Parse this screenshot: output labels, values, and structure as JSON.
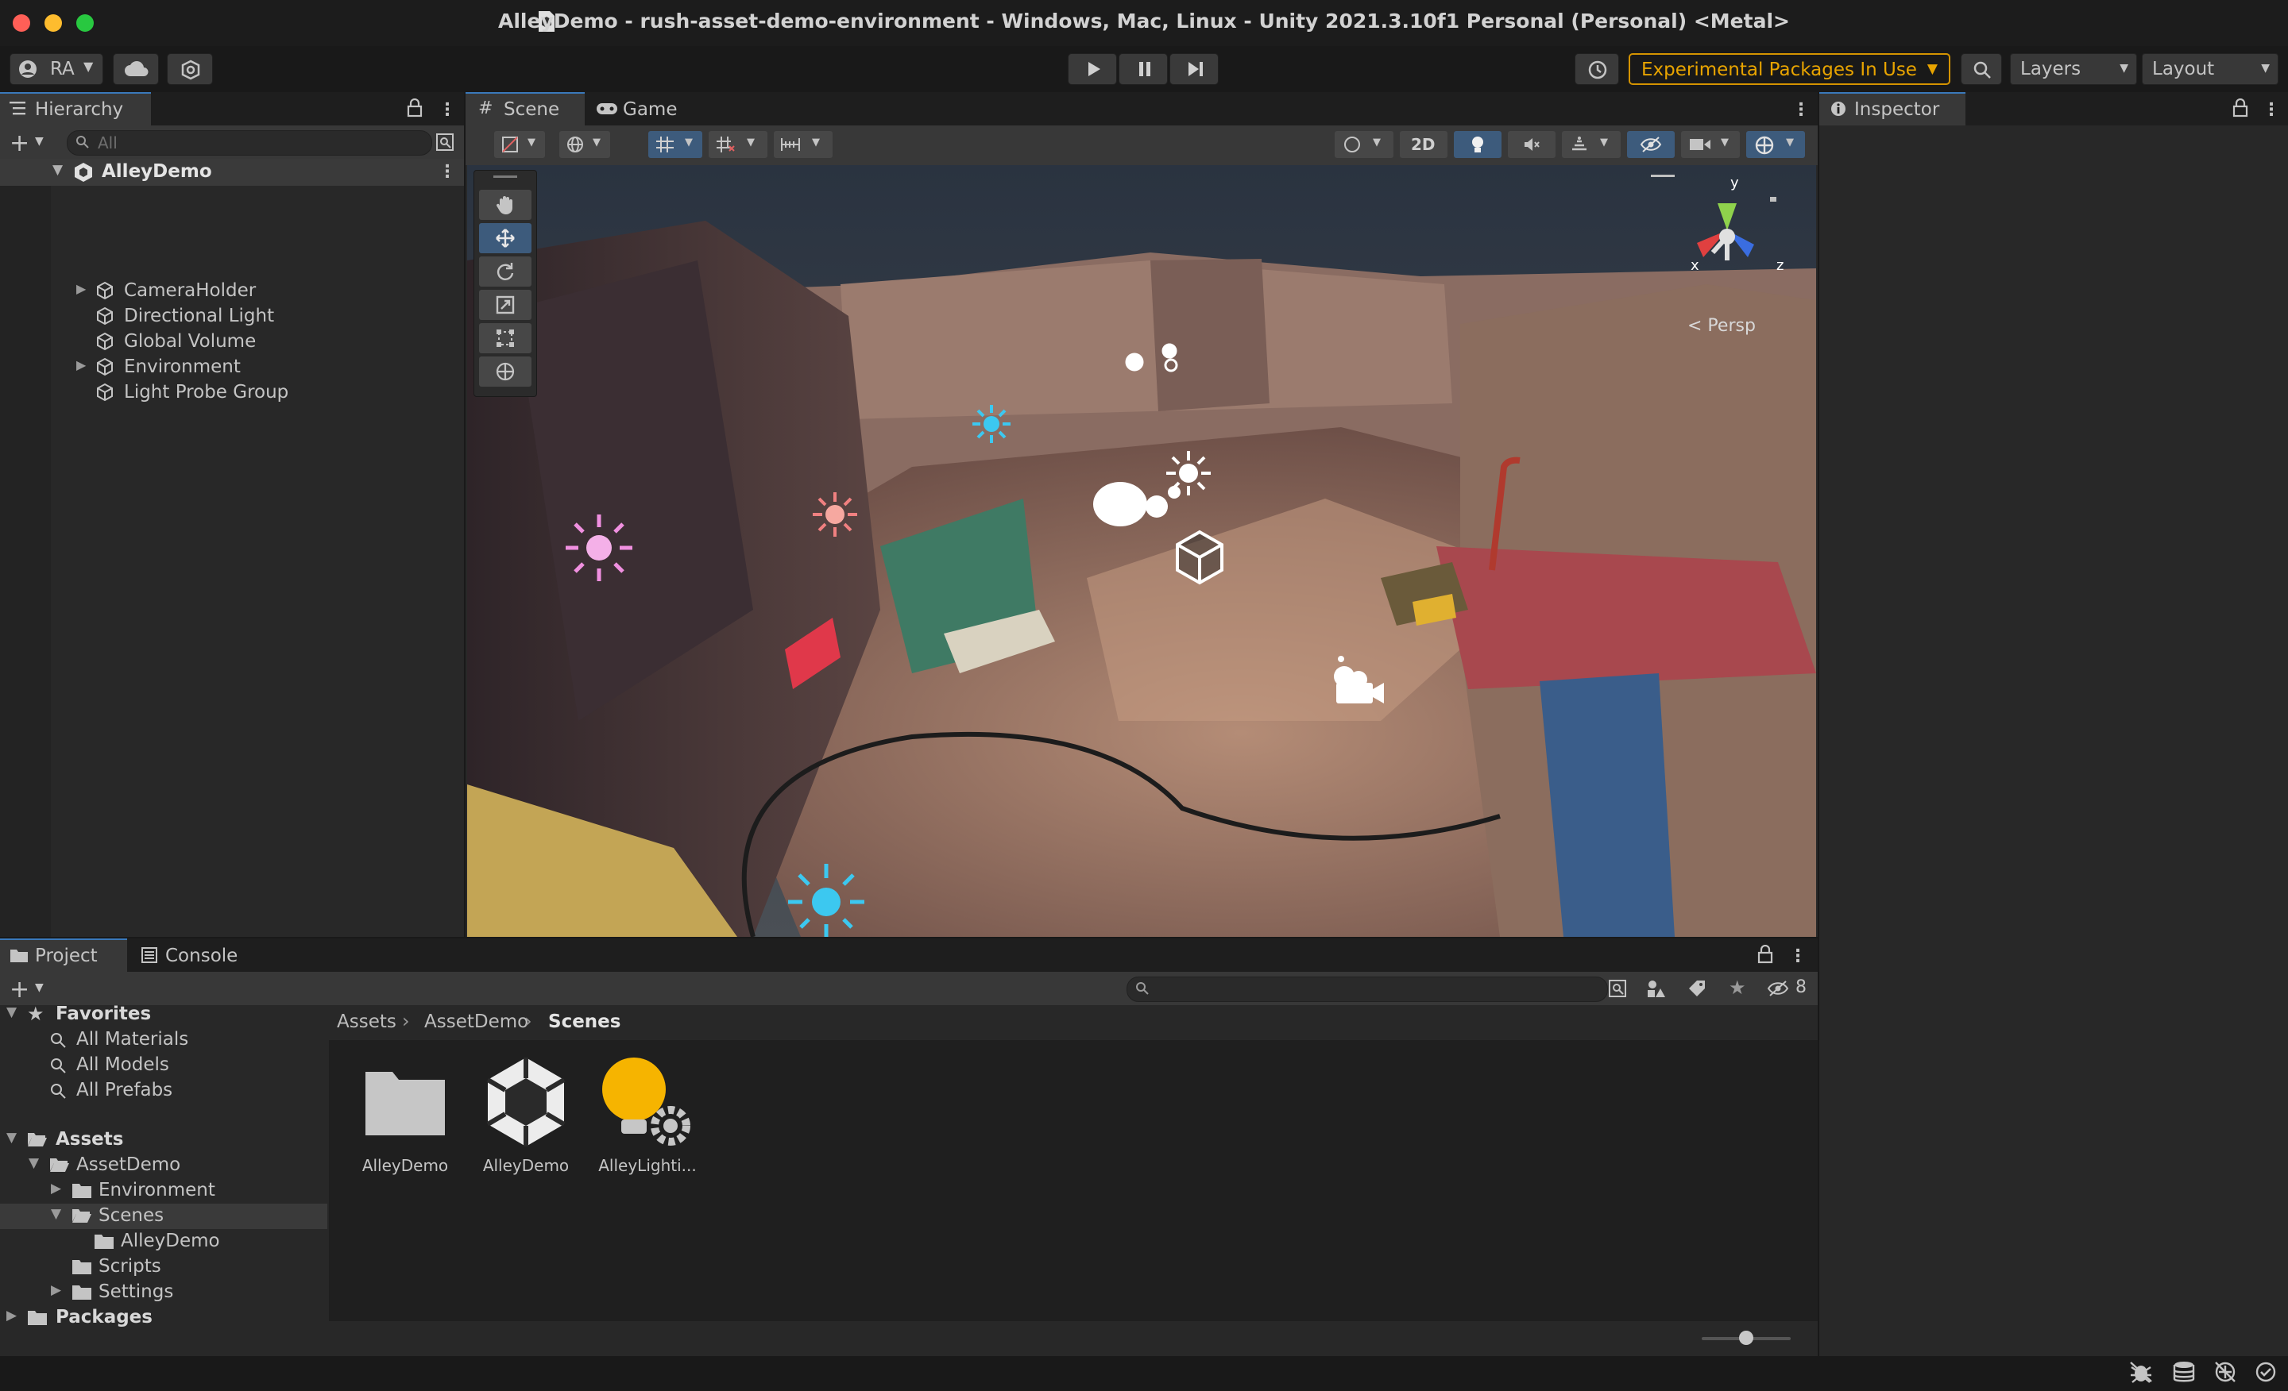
{
  "window": {
    "title": "AlleyDemo - rush-asset-demo-environment - Windows, Mac, Linux - Unity 2021.3.10f1 Personal (Personal) <Metal>"
  },
  "toolbar": {
    "account": "RA",
    "experimental": "Experimental Packages In Use",
    "layers": "Layers",
    "layout": "Layout"
  },
  "hierarchy": {
    "tab": "Hierarchy",
    "search_placeholder": "All",
    "scene": "AlleyDemo",
    "items": [
      {
        "label": "CameraHolder",
        "expandable": true
      },
      {
        "label": "Directional Light",
        "expandable": false
      },
      {
        "label": "Global Volume",
        "expandable": false
      },
      {
        "label": "Environment",
        "expandable": true
      },
      {
        "label": "Light Probe Group",
        "expandable": false
      }
    ]
  },
  "center": {
    "tabs": [
      "Scene",
      "Game"
    ],
    "mode_2d": "2D",
    "persp": "< Persp",
    "axes": {
      "x": "x",
      "y": "y",
      "z": "z"
    }
  },
  "inspector": {
    "tab": "Inspector"
  },
  "project": {
    "tabs": [
      "Project",
      "Console"
    ],
    "hidden_count": "8",
    "favorites": {
      "label": "Favorites",
      "items": [
        "All Materials",
        "All Models",
        "All Prefabs"
      ]
    },
    "assets": {
      "label": "Assets",
      "assetdemo": "AssetDemo",
      "environment": "Environment",
      "scenes": "Scenes",
      "alleydemo": "AlleyDemo",
      "scripts": "Scripts",
      "settings": "Settings"
    },
    "packages": "Packages",
    "breadcrumb": [
      "Assets",
      "AssetDemo",
      "Scenes"
    ],
    "files": [
      {
        "name": "AlleyDemo",
        "icon": "folder-icon"
      },
      {
        "name": "AlleyDemo",
        "icon": "unity-scene-icon"
      },
      {
        "name": "AlleyLighti...",
        "icon": "lighting-settings-icon"
      }
    ],
    "zoom_level": 0.5
  },
  "colors": {
    "accent": "#3a79bb",
    "warning": "#e8a400",
    "panel": "#282828",
    "light_blue": "#3cc8f0",
    "light_pink": "#f090e0"
  }
}
